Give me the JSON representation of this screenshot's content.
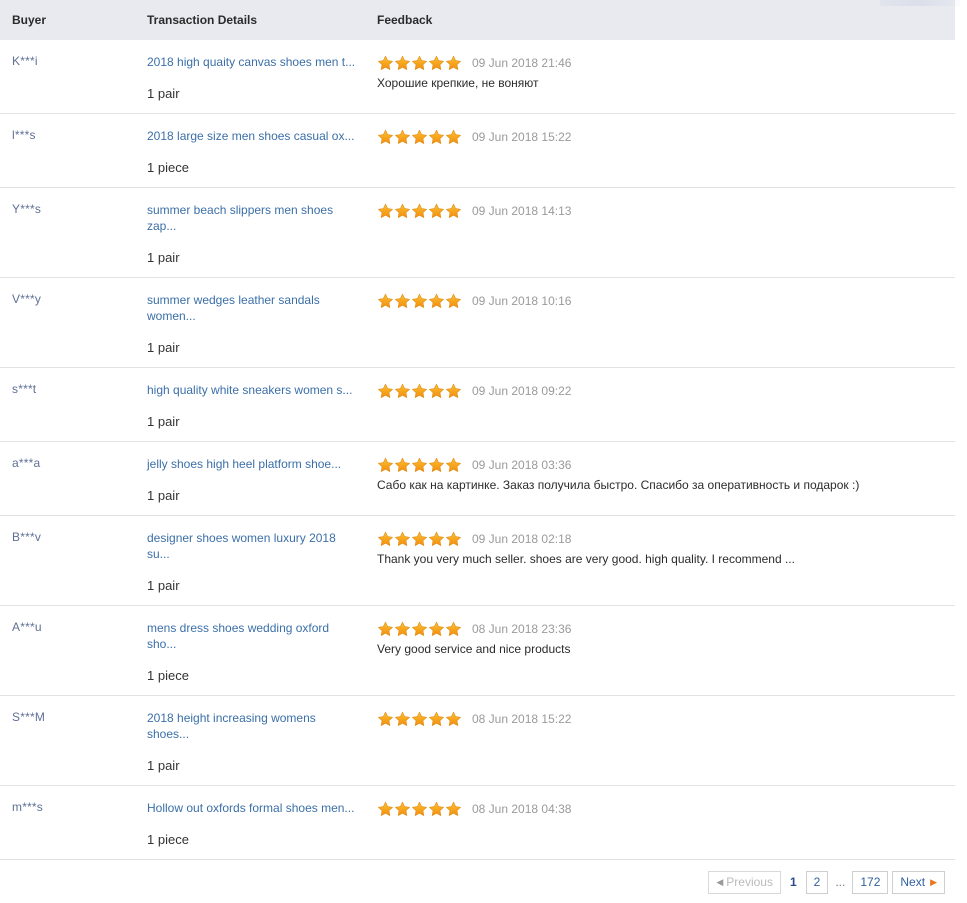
{
  "table": {
    "columns": [
      {
        "key": "buyer",
        "label": "Buyer"
      },
      {
        "key": "transaction",
        "label": "Transaction Details"
      },
      {
        "key": "feedback",
        "label": "Feedback"
      }
    ],
    "rows": [
      {
        "buyer": "K***i",
        "product": "2018 high quaity canvas shoes men t...",
        "quantity": "1 pair",
        "rating": 5,
        "date": "09 Jun 2018 21:46",
        "comment": "Хорошие крепкие, не воняют"
      },
      {
        "buyer": "l***s",
        "product": "2018 large size men shoes casual ox...",
        "quantity": "1 piece",
        "rating": 5,
        "date": "09 Jun 2018 15:22",
        "comment": ""
      },
      {
        "buyer": "Y***s",
        "product": "summer beach slippers men shoes zap...",
        "quantity": "1 pair",
        "rating": 5,
        "date": "09 Jun 2018 14:13",
        "comment": ""
      },
      {
        "buyer": "V***y",
        "product": "summer wedges leather sandals women...",
        "quantity": "1 pair",
        "rating": 5,
        "date": "09 Jun 2018 10:16",
        "comment": ""
      },
      {
        "buyer": "s***t",
        "product": "high quality white sneakers women s...",
        "quantity": "1 pair",
        "rating": 5,
        "date": "09 Jun 2018 09:22",
        "comment": ""
      },
      {
        "buyer": "a***a",
        "product": "jelly shoes high heel platform shoe...",
        "quantity": "1 pair",
        "rating": 5,
        "date": "09 Jun 2018 03:36",
        "comment": "Сабо как на картинке. Заказ получила быстро. Спасибо за оперативность и подарок :)"
      },
      {
        "buyer": "B***v",
        "product": "designer shoes women luxury 2018 su...",
        "quantity": "1 pair",
        "rating": 5,
        "date": "09 Jun 2018 02:18",
        "comment": "Thank you very much seller. shoes are very good. high quality. I recommend ..."
      },
      {
        "buyer": "A***u",
        "product": "mens dress shoes wedding oxford sho...",
        "quantity": "1 piece",
        "rating": 5,
        "date": "08 Jun 2018 23:36",
        "comment": "Very good service and nice products"
      },
      {
        "buyer": "S***M",
        "product": "2018 height increasing womens shoes...",
        "quantity": "1 pair",
        "rating": 5,
        "date": "08 Jun 2018 15:22",
        "comment": ""
      },
      {
        "buyer": "m***s",
        "product": "Hollow out oxfords formal shoes men...",
        "quantity": "1 piece",
        "rating": 5,
        "date": "08 Jun 2018 04:38",
        "comment": ""
      }
    ]
  },
  "pagination": {
    "previous_label": "Previous",
    "next_label": "Next",
    "ellipsis": "...",
    "pages": [
      "1",
      "2"
    ],
    "last_page": "172",
    "current_page": "1",
    "previous_enabled": false,
    "next_enabled": true,
    "prev_caret_icon": "caret-left-icon",
    "next_caret_icon": "caret-right-icon"
  },
  "colors": {
    "header_bg": "#e8eaf0",
    "link": "#3b6fa8",
    "star": "#f5a623",
    "date": "#9a9a9a",
    "pager_accent": "#2f5f9e",
    "next_caret": "#e87722"
  },
  "icons": {
    "star": "star-icon"
  }
}
